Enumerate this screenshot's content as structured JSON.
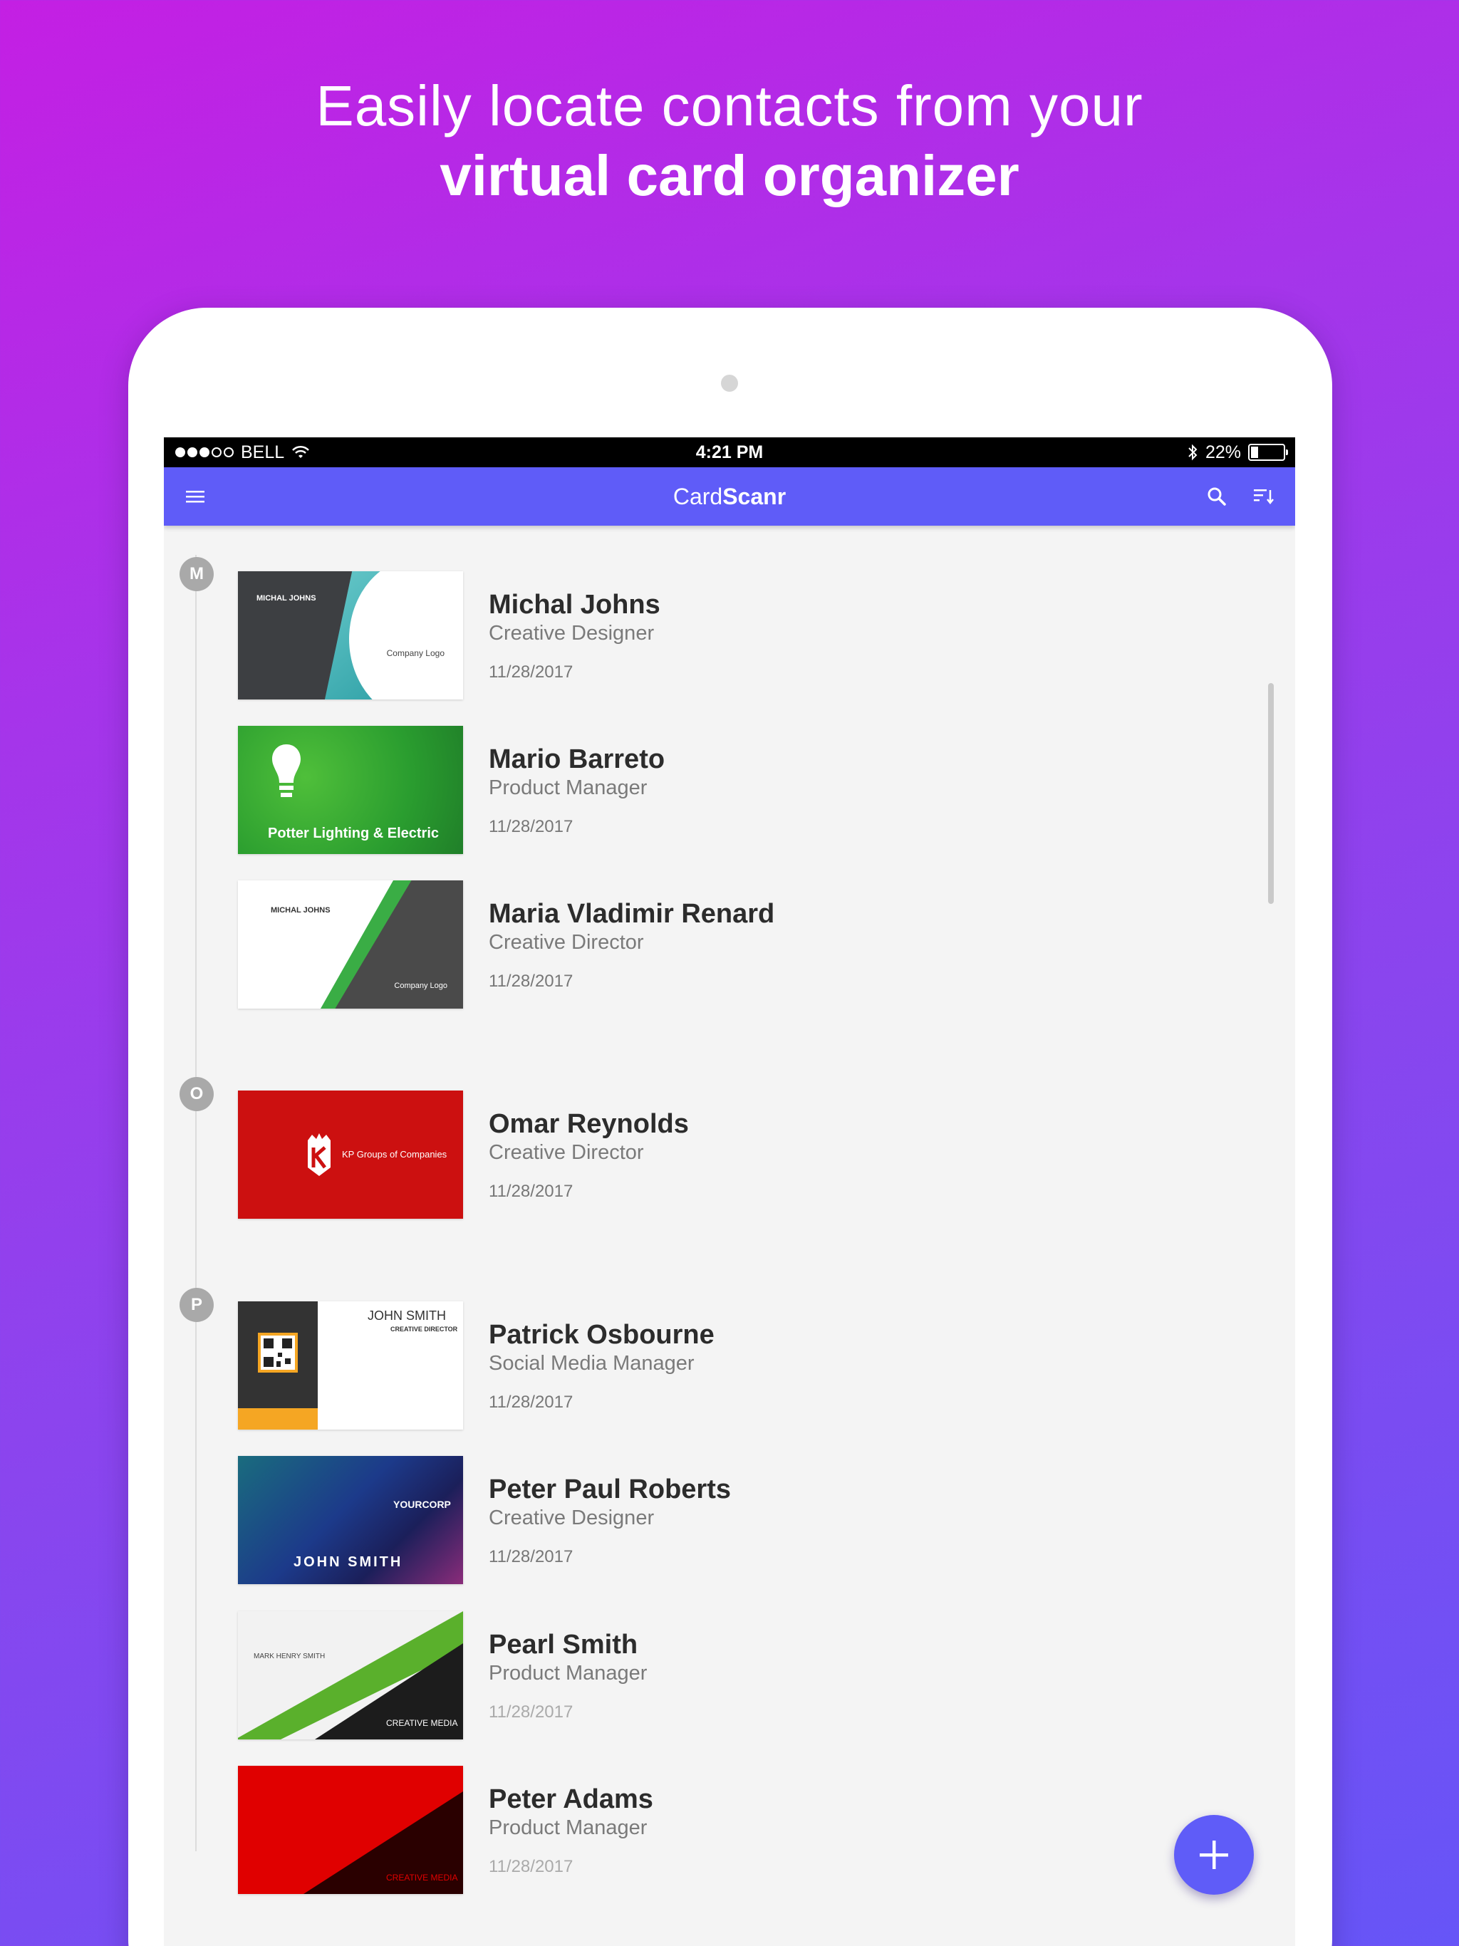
{
  "headline": {
    "line1": "Easily locate contacts from your",
    "line2": "virtual card organizer"
  },
  "statusbar": {
    "carrier": "BELL",
    "time": "4:21 PM",
    "battery": "22%",
    "signal_bars": 3,
    "battery_level": 0.22
  },
  "appbar": {
    "title_light": "Card",
    "title_bold": "Scanr",
    "icons": [
      "menu-icon",
      "search-icon",
      "sort-icon"
    ]
  },
  "groups": [
    {
      "letter": "M"
    },
    {
      "letter": "O"
    },
    {
      "letter": "P"
    }
  ],
  "contacts": [
    {
      "name": "Michal Johns",
      "role": "Creative Designer",
      "date": "11/28/2017"
    },
    {
      "name": "Mario Barreto",
      "role": "Product Manager",
      "date": "11/28/2017"
    },
    {
      "name": "Maria Vladimir Renard",
      "role": "Creative Director",
      "date": "11/28/2017"
    },
    {
      "name": "Omar Reynolds",
      "role": "Creative Director",
      "date": "11/28/2017"
    },
    {
      "name": "Patrick Osbourne",
      "role": "Social Media Manager",
      "date": "11/28/2017"
    },
    {
      "name": "Peter Paul Roberts",
      "role": "Creative Designer",
      "date": "11/28/2017"
    },
    {
      "name": "Pearl Smith",
      "role": "Product Manager",
      "date": "11/28/2017"
    },
    {
      "name": "Peter Adams",
      "role": "Product Manager",
      "date": "11/28/2017"
    }
  ],
  "card_texts": {
    "c1_name": "MICHAL JOHNS",
    "c1_logo": "Company Logo",
    "c2_company": "Potter Lighting & Electric",
    "c3_name": "MICHAL JOHNS",
    "c3_logo": "Company Logo",
    "c4_company": "KP Groups of Companies",
    "c5_name": "JOHN SMITH",
    "c5_title": "CREATIVE DIRECTOR",
    "c6_brand": "YOURCORP",
    "c6_name": "JOHN SMITH",
    "c7_name": "MARK HENRY SMITH",
    "c7_brand": "CREATIVE MEDIA",
    "c8_brand": "CREATIVE MEDIA"
  },
  "colors": {
    "accent": "#5f5cf8",
    "background_start": "#c41fe3",
    "background_end": "#6655f7"
  }
}
